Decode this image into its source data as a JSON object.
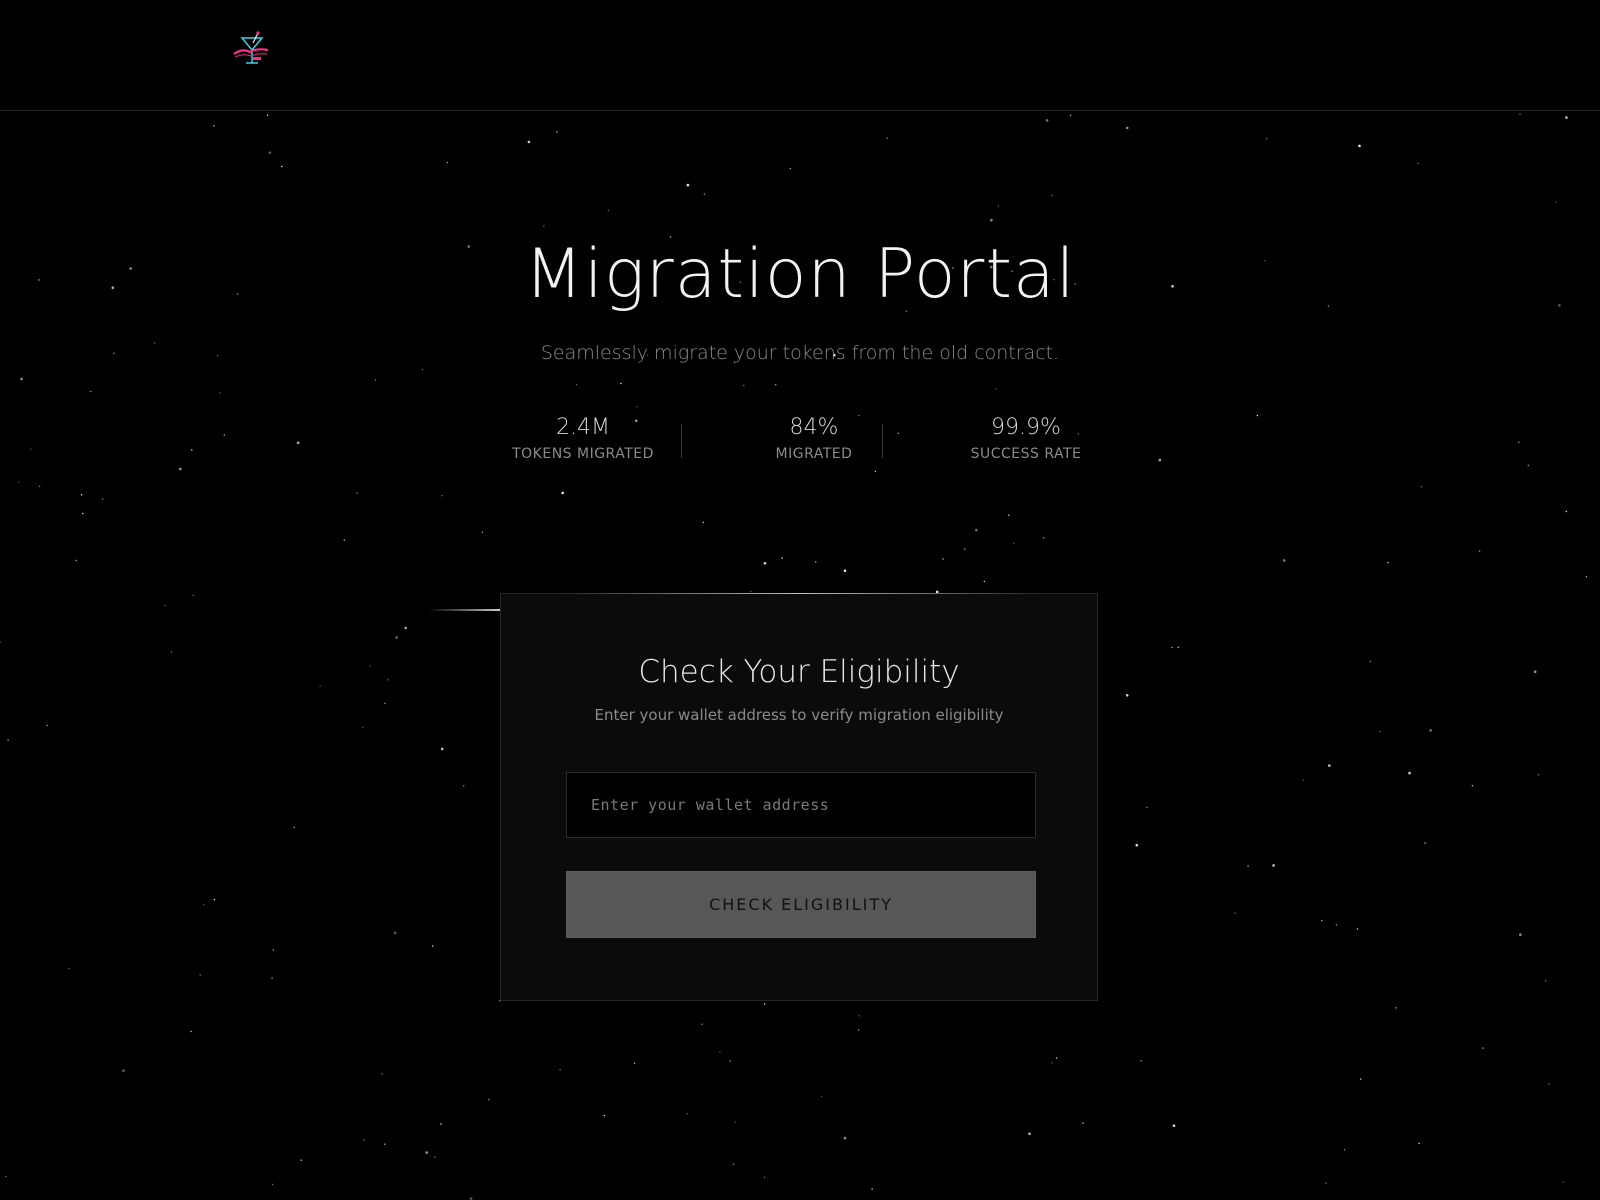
{
  "header": {
    "logo_name": "cocktail-logo-icon"
  },
  "hero": {
    "title": "Migration Portal",
    "subtitle": "Seamlessly migrate your tokens from the old contract."
  },
  "stats": [
    {
      "value": "2.4M",
      "label": "TOKENS MIGRATED"
    },
    {
      "value": "84%",
      "label": "MIGRATED"
    },
    {
      "value": "99.9%",
      "label": "SUCCESS RATE"
    }
  ],
  "card": {
    "title": "Check Your Eligibility",
    "subtitle": "Enter your wallet address to verify migration eligibility",
    "input_placeholder": "Enter your wallet address",
    "input_value": "",
    "button_label": "CHECK ELIGIBILITY"
  },
  "colors": {
    "background": "#000000",
    "card": "#0b0b0b",
    "button": "#575757",
    "logo_pink": "#ff2d8a",
    "logo_cyan": "#3fd0e0"
  }
}
